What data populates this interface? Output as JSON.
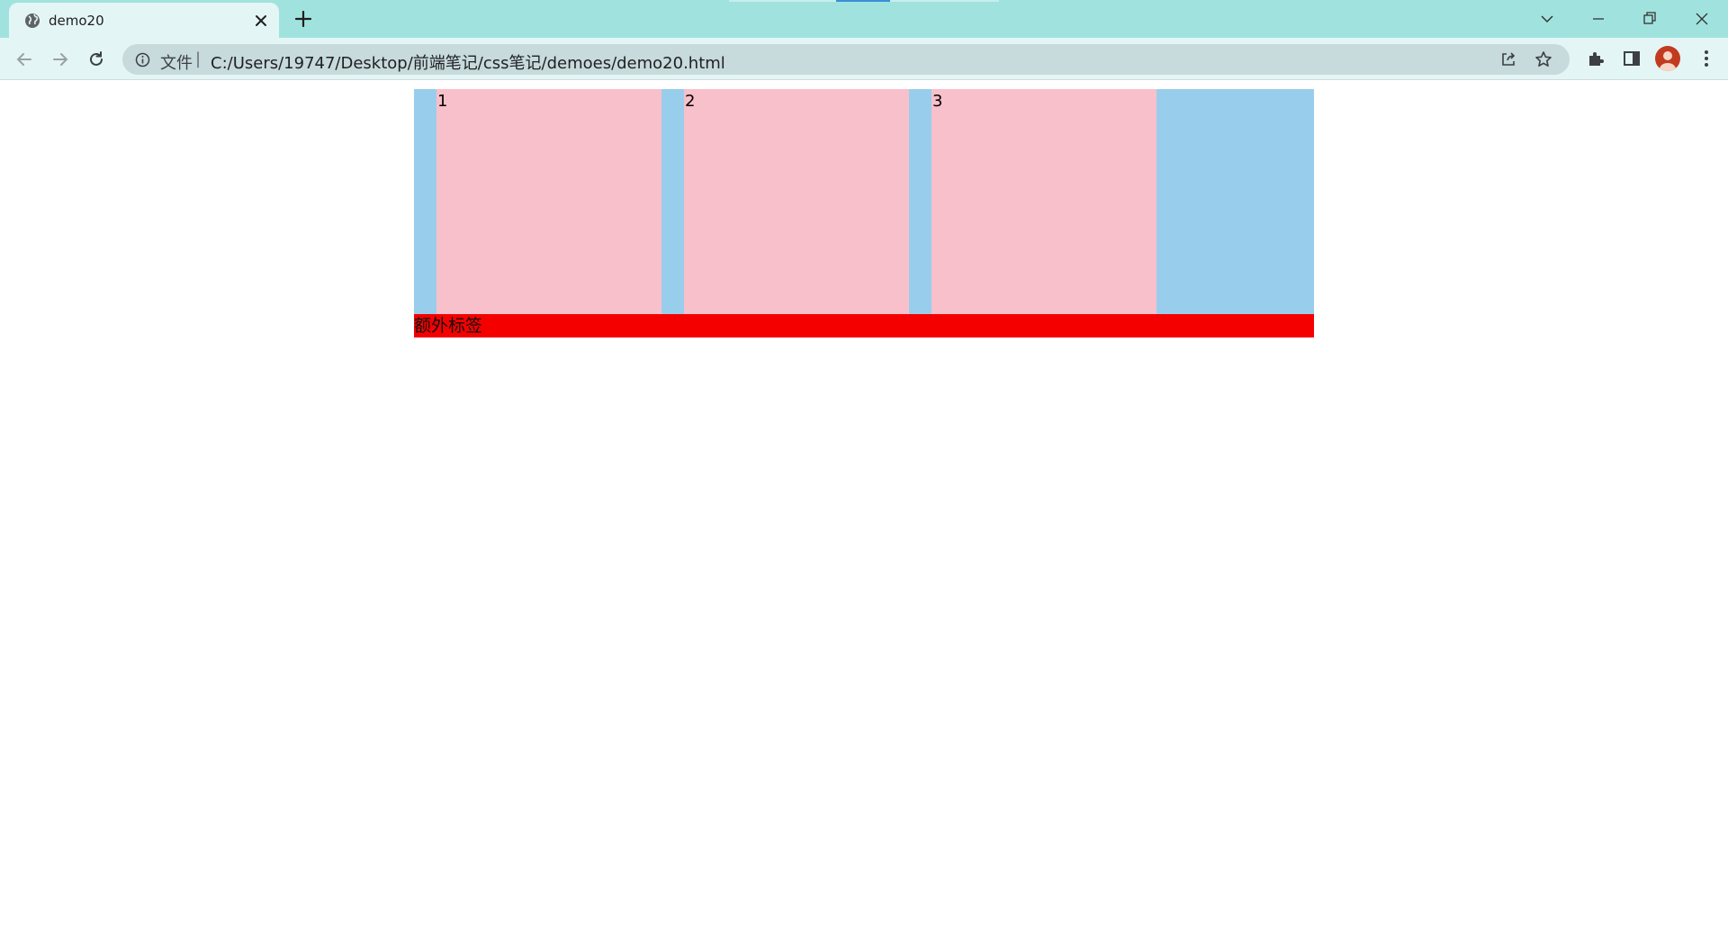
{
  "browser": {
    "tab_title": "demo20",
    "security_label": "文件",
    "url_separator": "|",
    "url": "C:/Users/19747/Desktop/前端笔记/css笔记/demoes/demo20.html"
  },
  "page": {
    "boxes": [
      {
        "label": "1"
      },
      {
        "label": "2"
      },
      {
        "label": "3"
      }
    ],
    "extra_label": "额外标签"
  },
  "colors": {
    "tabbar": "#a0e3de",
    "toolbar": "#e4f5f5",
    "container": "#98ceeb",
    "box": "#f8c0cb",
    "extra": "#f50000"
  },
  "icons": [
    "globe-icon",
    "close-icon",
    "plus-icon",
    "chevron-down-icon",
    "minimize-icon",
    "restore-icon",
    "close-window-icon",
    "back-arrow-icon",
    "forward-arrow-icon",
    "reload-icon",
    "info-icon",
    "share-icon",
    "star-icon",
    "puzzle-icon",
    "side-panel-icon",
    "avatar",
    "more-icon"
  ]
}
